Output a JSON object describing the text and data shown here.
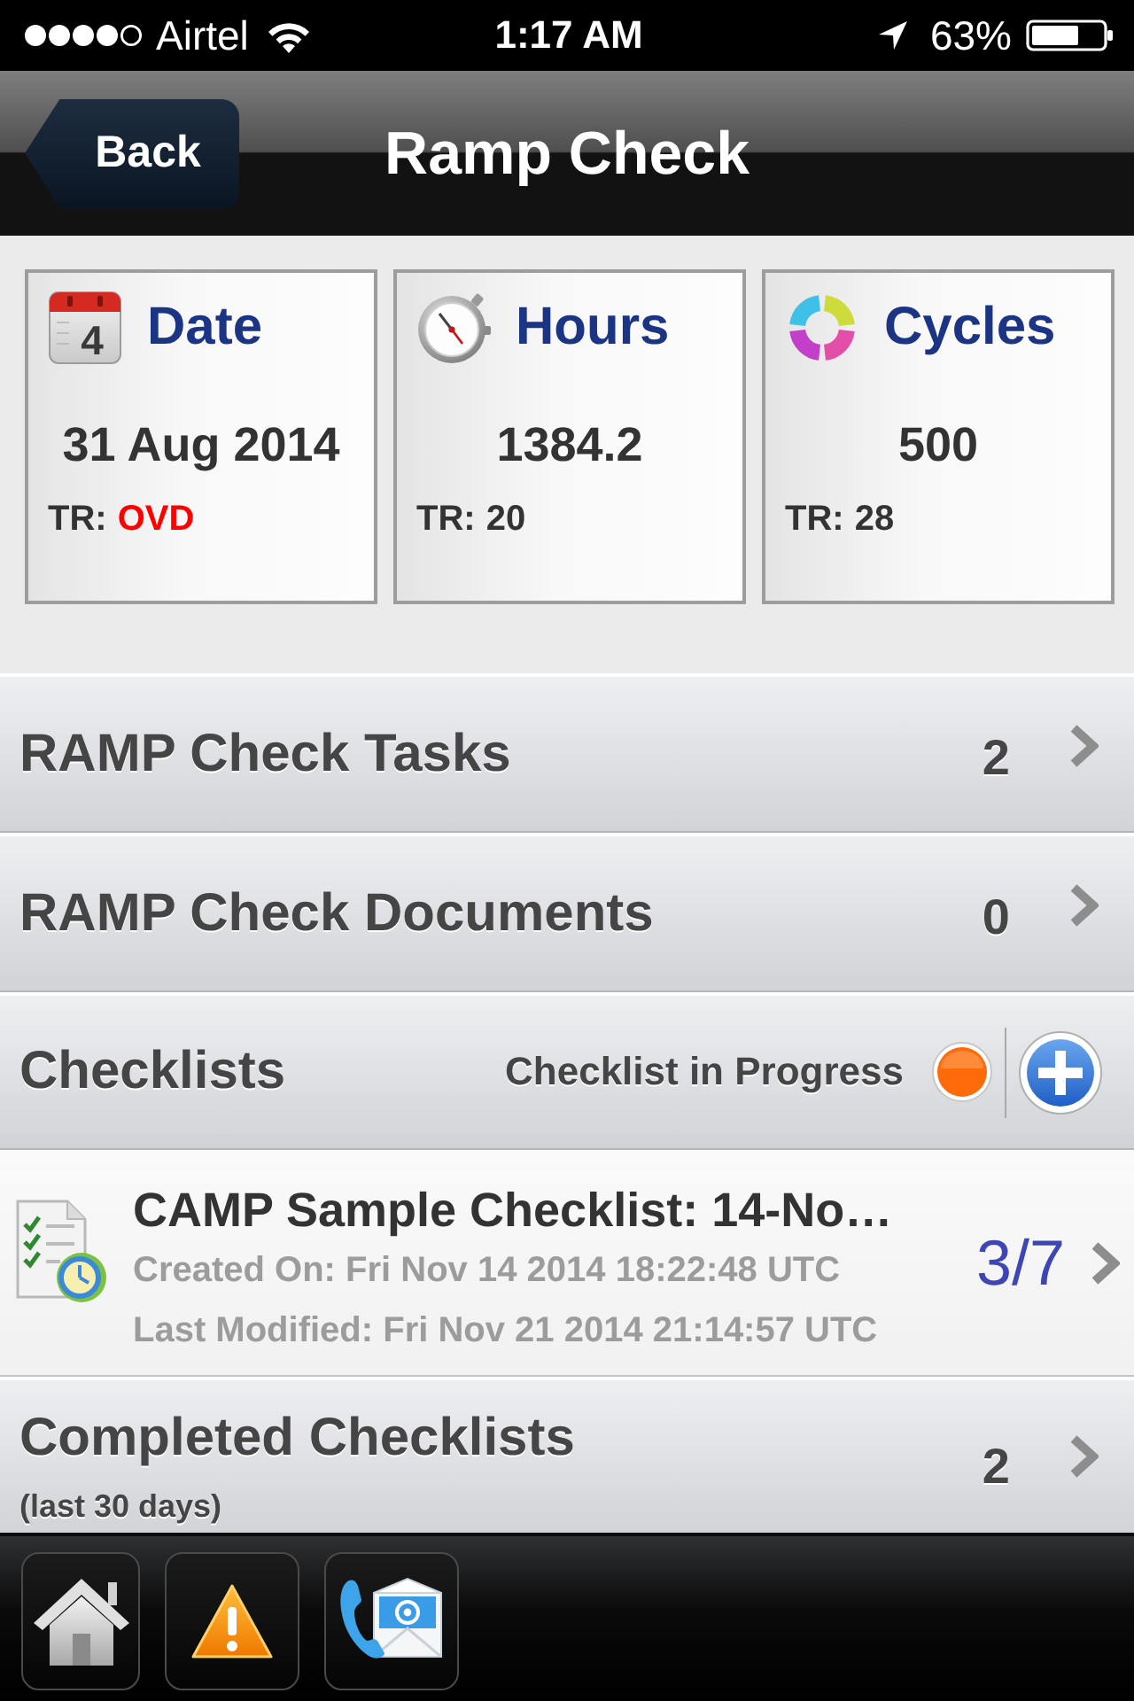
{
  "status_bar": {
    "carrier": "Airtel",
    "time": "1:17 AM",
    "battery": "63%"
  },
  "nav_bar": {
    "back_button": "Back",
    "title": "Ramp Check"
  },
  "summary_cards": [
    {
      "kind": "date",
      "icon_day": "4",
      "label": "Date",
      "value": "31 Aug 2014",
      "tr_label": "TR:",
      "tr_value": "OVD",
      "overdue": true
    },
    {
      "kind": "hours",
      "label": "Hours",
      "value": "1384.2",
      "tr_label": "TR:",
      "tr_value": "20",
      "overdue": false
    },
    {
      "kind": "cycles",
      "label": "Cycles",
      "value": "500",
      "tr_label": "TR:",
      "tr_value": "28",
      "overdue": false
    }
  ],
  "menu_rows": [
    {
      "label": "RAMP Check Tasks",
      "count": "2"
    },
    {
      "label": "RAMP Check Documents",
      "count": "0"
    }
  ],
  "checklists": {
    "title": "Checklists",
    "legend": "Checklist in Progress",
    "items": [
      {
        "title": "CAMP Sample Checklist: 14-No…",
        "created": "Created On: Fri Nov 14 2014 18:22:48 UTC",
        "modified": "Last Modified: Fri Nov 21 2014 21:14:57 UTC",
        "progress": "3/7"
      }
    ]
  },
  "completed_checklists": {
    "label": "Completed Checklists",
    "note": "(last 30 days)",
    "count": "2"
  },
  "tab_bar": [
    {
      "kind": "home"
    },
    {
      "kind": "alert"
    },
    {
      "kind": "contact"
    }
  ]
}
